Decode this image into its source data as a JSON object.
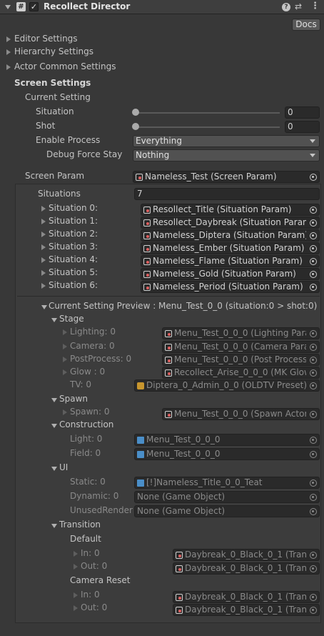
{
  "header": {
    "title": "Recollect Director",
    "script_icon": "#",
    "enabled": true,
    "docs_label": "Docs"
  },
  "foldouts": [
    "Editor Settings",
    "Hierarchy Settings",
    "Actor Common Settings"
  ],
  "screen_settings": {
    "title": "Screen Settings",
    "current_setting": "Current Setting",
    "situation_label": "Situation",
    "situation_value": "0",
    "situation_slider_fraction": 0,
    "shot_label": "Shot",
    "shot_value": "0",
    "shot_slider_fraction": 0,
    "enable_process_label": "Enable Process",
    "enable_process_value": "Everything",
    "debug_force_stay_label": "Debug Force Stay",
    "debug_force_stay_value": "Nothing",
    "screen_param_label": "Screen Param",
    "screen_param_value": "Nameless_Test (Screen Param)"
  },
  "situations": {
    "label": "Situations",
    "count": "7",
    "items": [
      {
        "label": "Situation 0:",
        "value": "Resollect_Title (Situation Param)"
      },
      {
        "label": "Situation 1:",
        "value": "Resollect_Daybreak (Situation Param)"
      },
      {
        "label": "Situation 2:",
        "value": "Nameless_Diptera (Situation Param)"
      },
      {
        "label": "Situation 3:",
        "value": "Nameless_Ember (Situation Param)"
      },
      {
        "label": "Situation 4:",
        "value": "Nameless_Flame (Situation Param)"
      },
      {
        "label": "Situation 5:",
        "value": "Nameless_Gold (Situation Param)"
      },
      {
        "label": "Situation 6:",
        "value": "Nameless_Period (Situation Param)"
      }
    ]
  },
  "preview": {
    "title": "Current Setting Preview : Menu_Test_0_0 (situation:0 > shot:0)",
    "stage": {
      "label": "Stage",
      "lighting_label": "Lighting: 0",
      "lighting_value": "Menu_Test_0_0_0 (Lighting Param",
      "camera_label": "Camera: 0",
      "camera_value": "Menu_Test_0_0_0 (Camera Param",
      "postprocess_label": "PostProcess: 0",
      "postprocess_value": "Menu_Test_0_0_0 (Post Process",
      "glow_label": "Glow : 0",
      "glow_value": "Recollect_Arise_0_0_0 (MK Glow",
      "tv_label": "TV: 0",
      "tv_value": "Diptera_0_Admin_0_0 (OLDTV Preset)"
    },
    "spawn": {
      "label": "Spawn",
      "spawn_label": "Spawn: 0",
      "spawn_value": "Menu_Test_0_0_0 (Spawn Actors"
    },
    "construction": {
      "label": "Construction",
      "light_label": "Light: 0",
      "light_value": "Menu_Test_0_0_0",
      "field_label": "Field: 0",
      "field_value": "Menu_Test_0_0_0"
    },
    "ui": {
      "label": "UI",
      "static_label": "Static: 0",
      "static_value": "[!]Nameless_Title_0_0_Teat",
      "dynamic_label": "Dynamic: 0",
      "dynamic_value": "None (Game Object)",
      "unused_label": "UnusedRenderC",
      "unused_value": "None (Game Object)"
    },
    "transition": {
      "label": "Transition",
      "default_label": "Default",
      "in_label": "In: 0",
      "in_value": "Daybreak_0_Black_0_1 (Transi",
      "out_label": "Out: 0",
      "out_value": "Daybreak_0_Black_0_1 (Transi",
      "camera_reset_label": "Camera Reset",
      "cr_in_label": "In: 0",
      "cr_in_value": "Daybreak_0_Black_0_1 (Transi",
      "cr_out_label": "Out: 0",
      "cr_out_value": "Daybreak_0_Black_0_1 (Transi"
    }
  }
}
